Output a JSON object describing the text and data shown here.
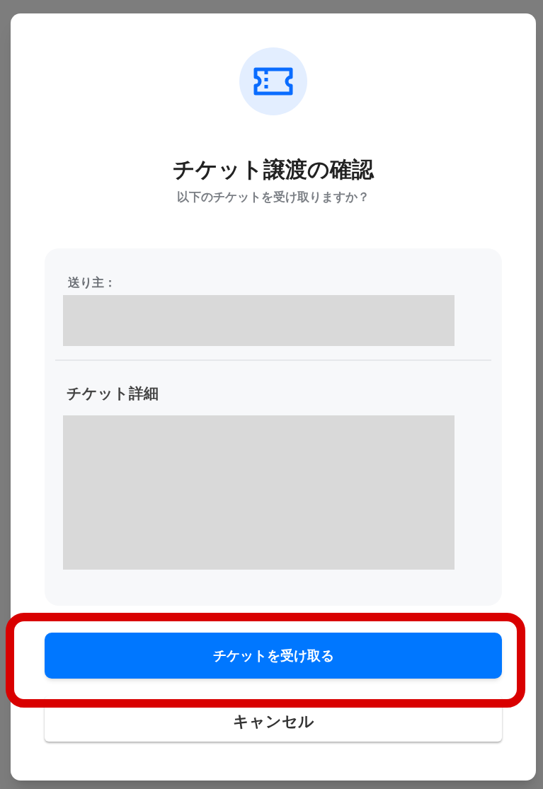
{
  "dialog": {
    "title": "チケット譲渡の確認",
    "subtitle": "以下のチケットを受け取りますか？",
    "sender": {
      "label": "送り主："
    },
    "details": {
      "heading": "チケット詳細"
    },
    "accept_button": {
      "label": "チケットを受け取る",
      "highlighted": true
    },
    "cancel_button": {
      "label": "キャンセル"
    }
  }
}
